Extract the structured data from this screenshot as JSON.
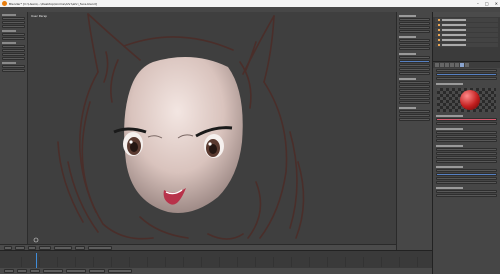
{
  "window": {
    "title": "Blender* [C:\\Users\\...\\Desktop\\Anime\\Ahri\\ahri_face.blend]",
    "controls": {
      "minimize": "–",
      "maximize": "□",
      "close": "✕"
    }
  },
  "viewport": {
    "label": "User Persp"
  },
  "colors": {
    "accent": "#5680c2",
    "sketch_line": "#4a2e2a",
    "skin": "#e8d5cf",
    "material_ball": "#c21f1f",
    "timeline_playhead": "#3f8cd9"
  },
  "icons": {
    "app": "blender-icon",
    "material_preview": "sphere-icon"
  }
}
